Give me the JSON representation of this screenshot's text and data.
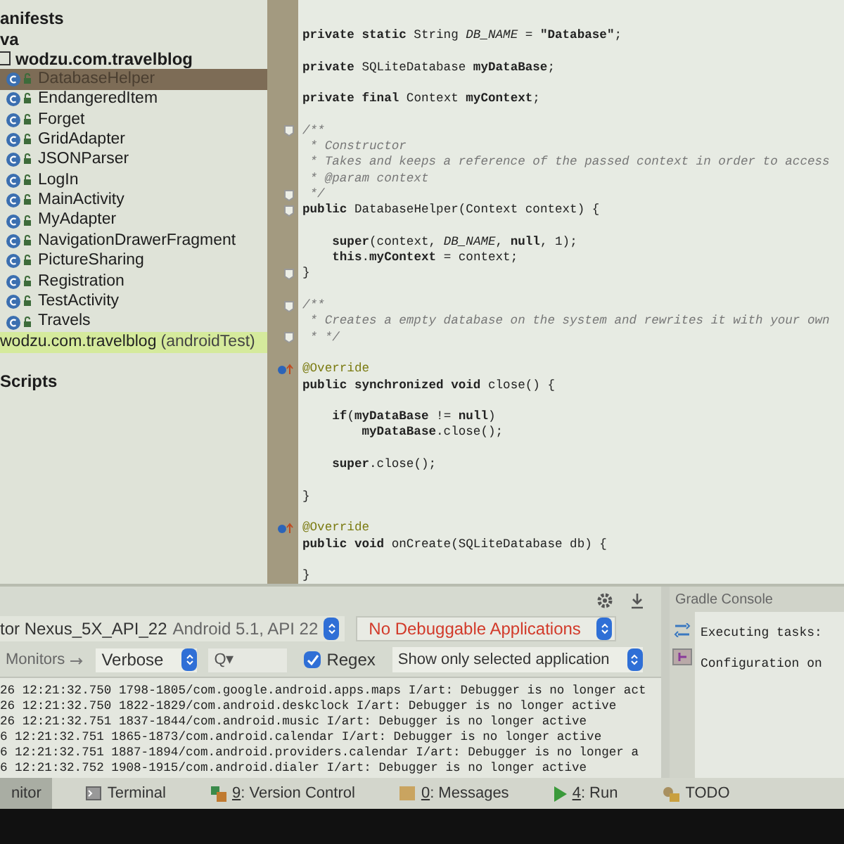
{
  "project_tree": [
    {
      "label": "anifests",
      "kind": "folder",
      "selected": false
    },
    {
      "label": "va",
      "kind": "folder",
      "selected": false
    },
    {
      "label": "wodzu.com.travelblog",
      "kind": "package",
      "selected": false,
      "children": [
        {
          "label": "DatabaseHelper",
          "kind": "class",
          "selected": true
        },
        {
          "label": "EndangeredItem",
          "kind": "class",
          "selected": false
        },
        {
          "label": "Forget",
          "kind": "class",
          "selected": false
        },
        {
          "label": "GridAdapter",
          "kind": "class",
          "selected": false
        },
        {
          "label": "JSONParser",
          "kind": "class",
          "selected": false
        },
        {
          "label": "LogIn",
          "kind": "class",
          "selected": false
        },
        {
          "label": "MainActivity",
          "kind": "class",
          "selected": false
        },
        {
          "label": "MyAdapter",
          "kind": "class",
          "selected": false
        },
        {
          "label": "NavigationDrawerFragment",
          "kind": "class",
          "selected": false
        },
        {
          "label": "PictureSharing",
          "kind": "class",
          "selected": false
        },
        {
          "label": "Registration",
          "kind": "class",
          "selected": false
        },
        {
          "label": "TestActivity",
          "kind": "class",
          "selected": false
        },
        {
          "label": "Travels",
          "kind": "class",
          "selected": false
        }
      ]
    },
    {
      "label": "wodzu.com.travelblog",
      "note": "(androidTest)",
      "kind": "test",
      "selected": false
    },
    {
      "label": "Scripts",
      "kind": "folder",
      "selected": false
    }
  ],
  "editor": {
    "lines": [
      {
        "kind": "code",
        "text": "**private static** String *DB_NAME* = **\"Database\"**;"
      },
      {
        "kind": "code",
        "blank_before": true,
        "text": "**private** SQLiteDatabase **myDataBase**;"
      },
      {
        "kind": "code",
        "blank_before": true,
        "text": "**private final** Context **myContext**;"
      },
      {
        "kind": "comment",
        "blank_before": true,
        "fold_marker": true,
        "text": "/**"
      },
      {
        "kind": "comment",
        "text": " * Constructor"
      },
      {
        "kind": "comment",
        "text": " * Takes and keeps a reference of the passed context in order to access"
      },
      {
        "kind": "comment",
        "text": " * @param context"
      },
      {
        "kind": "comment",
        "fold_marker": true,
        "text": " */"
      },
      {
        "kind": "code",
        "fold_marker": true,
        "text": "**public** DatabaseHelper(Context context) {"
      },
      {
        "kind": "code",
        "blank_before": true,
        "text": "    **super**(context, *DB_NAME*, **null**, 1);"
      },
      {
        "kind": "code",
        "text": "    **this**.**myContext** = context;"
      },
      {
        "kind": "code",
        "fold_marker": true,
        "text": "}"
      },
      {
        "kind": "comment",
        "blank_before": true,
        "fold_marker": true,
        "text": "/**"
      },
      {
        "kind": "comment",
        "text": " * Creates a empty database on the system and rewrites it with your own"
      },
      {
        "kind": "comment",
        "fold_marker": true,
        "text": " * */"
      },
      {
        "kind": "annotation",
        "blank_before": true,
        "override_marker": true,
        "text": "@Override"
      },
      {
        "kind": "code",
        "text": "**public synchronized void** close() {"
      },
      {
        "kind": "code",
        "blank_before": true,
        "text": "    **if**(**myDataBase** != **null**)"
      },
      {
        "kind": "code",
        "text": "        **myDataBase**.close();"
      },
      {
        "kind": "code",
        "blank_before": true,
        "text": "    **super**.close();"
      },
      {
        "kind": "code",
        "blank_before": true,
        "text": "}"
      },
      {
        "kind": "annotation",
        "blank_before": true,
        "override_marker": true,
        "text": "@Override"
      },
      {
        "kind": "code",
        "text": "**public void** onCreate(SQLiteDatabase db) {"
      },
      {
        "kind": "code",
        "blank_before": true,
        "text": "}"
      }
    ]
  },
  "logcat": {
    "device": {
      "name": "tor Nexus_5X_API_22",
      "detail": "Android 5.1, API 22"
    },
    "app_select": "No Debuggable Applications",
    "monitors_tab": "Monitors",
    "level_select": "Verbose",
    "search": {
      "placeholder": "Q▾"
    },
    "regex": {
      "label": "Regex",
      "checked": true
    },
    "filter_select": "Show only selected application",
    "lines": [
      "26 12:21:32.750 1798-1805/com.google.android.apps.maps I/art: Debugger is no longer act",
      "26 12:21:32.750 1822-1829/com.android.deskclock I/art: Debugger is no longer active",
      "26 12:21:32.751 1837-1844/com.android.music I/art: Debugger is no longer active",
      "6 12:21:32.751 1865-1873/com.android.calendar I/art: Debugger is no longer active",
      "6 12:21:32.751 1887-1894/com.android.providers.calendar I/art: Debugger is no longer a",
      "6 12:21:32.752 1908-1915/com.android.dialer I/art: Debugger is no longer active"
    ]
  },
  "gradle_console": {
    "title": "Gradle Console",
    "lines": [
      "Executing tasks:",
      "Configuration on"
    ]
  },
  "tool_windows": [
    {
      "label": "nitor",
      "kind": "plain",
      "selected": true
    },
    {
      "label": "Terminal",
      "kind": "terminal",
      "selected": false
    },
    {
      "mnemonic": "9",
      "label": ": Version Control",
      "kind": "vcs",
      "selected": false
    },
    {
      "mnemonic": "0",
      "label": ": Messages",
      "kind": "messages",
      "selected": false
    },
    {
      "mnemonic": "4",
      "label": ": Run",
      "kind": "run",
      "selected": false
    },
    {
      "label": "TODO",
      "kind": "todo",
      "selected": false
    }
  ]
}
